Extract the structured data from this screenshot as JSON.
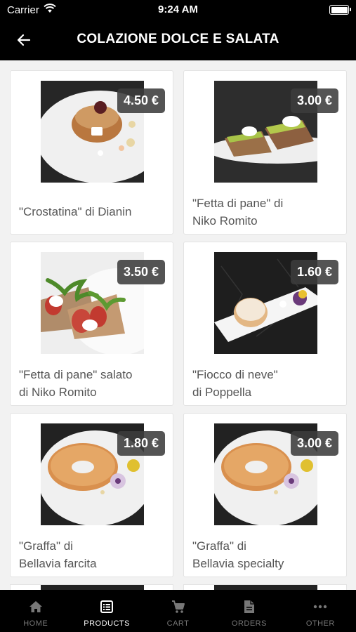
{
  "status": {
    "carrier": "Carrier",
    "time": "9:24 AM"
  },
  "header": {
    "title": "COLAZIONE DOLCE E SALATA"
  },
  "products": [
    {
      "name": "\"Crostatina\" di Dianin",
      "price": "4.50 €"
    },
    {
      "name": "\"Fetta di pane\" di\nNiko Romito",
      "price": "3.00 €"
    },
    {
      "name": "\"Fetta di pane\" salato\ndi Niko Romito",
      "price": "3.50 €"
    },
    {
      "name": "\"Fiocco di neve\"\ndi Poppella",
      "price": "1.60 €"
    },
    {
      "name": "\"Graffa\" di\nBellavia farcita",
      "price": "1.80 €"
    },
    {
      "name": "\"Graffa\" di\nBellavia specialty",
      "price": "3.00 €"
    }
  ],
  "tabs": [
    {
      "label": "HOME",
      "icon": "home-icon",
      "active": false
    },
    {
      "label": "PRODUCTS",
      "icon": "products-icon",
      "active": true
    },
    {
      "label": "CART",
      "icon": "cart-icon",
      "active": false
    },
    {
      "label": "ORDERS",
      "icon": "orders-icon",
      "active": false
    },
    {
      "label": "OTHER",
      "icon": "more-icon",
      "active": false
    }
  ]
}
